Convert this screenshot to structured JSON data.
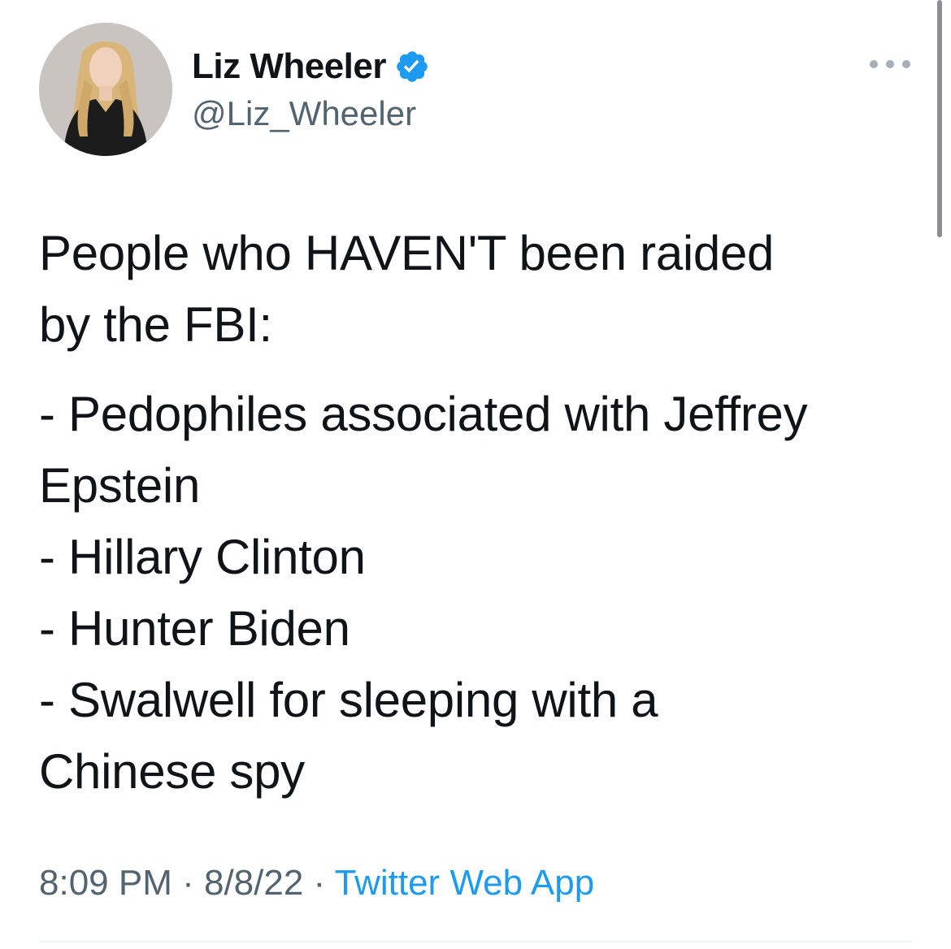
{
  "user": {
    "display_name": "Liz Wheeler",
    "handle": "@Liz_Wheeler",
    "verified": true,
    "verified_icon": "verified-badge-icon",
    "verified_color": "#1d9bf0"
  },
  "more_menu": {
    "icon": "more-horizontal-icon"
  },
  "tweet": {
    "paragraph1": [
      "People who HAVEN'T been raided",
      "by the FBI:"
    ],
    "paragraph2": [
      "- Pedophiles associated with Jeffrey",
      "Epstein",
      "- Hillary Clinton",
      "- Hunter Biden",
      "- Swalwell for sleeping with a",
      "Chinese spy"
    ]
  },
  "meta": {
    "time": "8:09 PM",
    "separator": " · ",
    "date": "8/8/22",
    "source": "Twitter Web App",
    "source_color": "#1d9bf0"
  }
}
